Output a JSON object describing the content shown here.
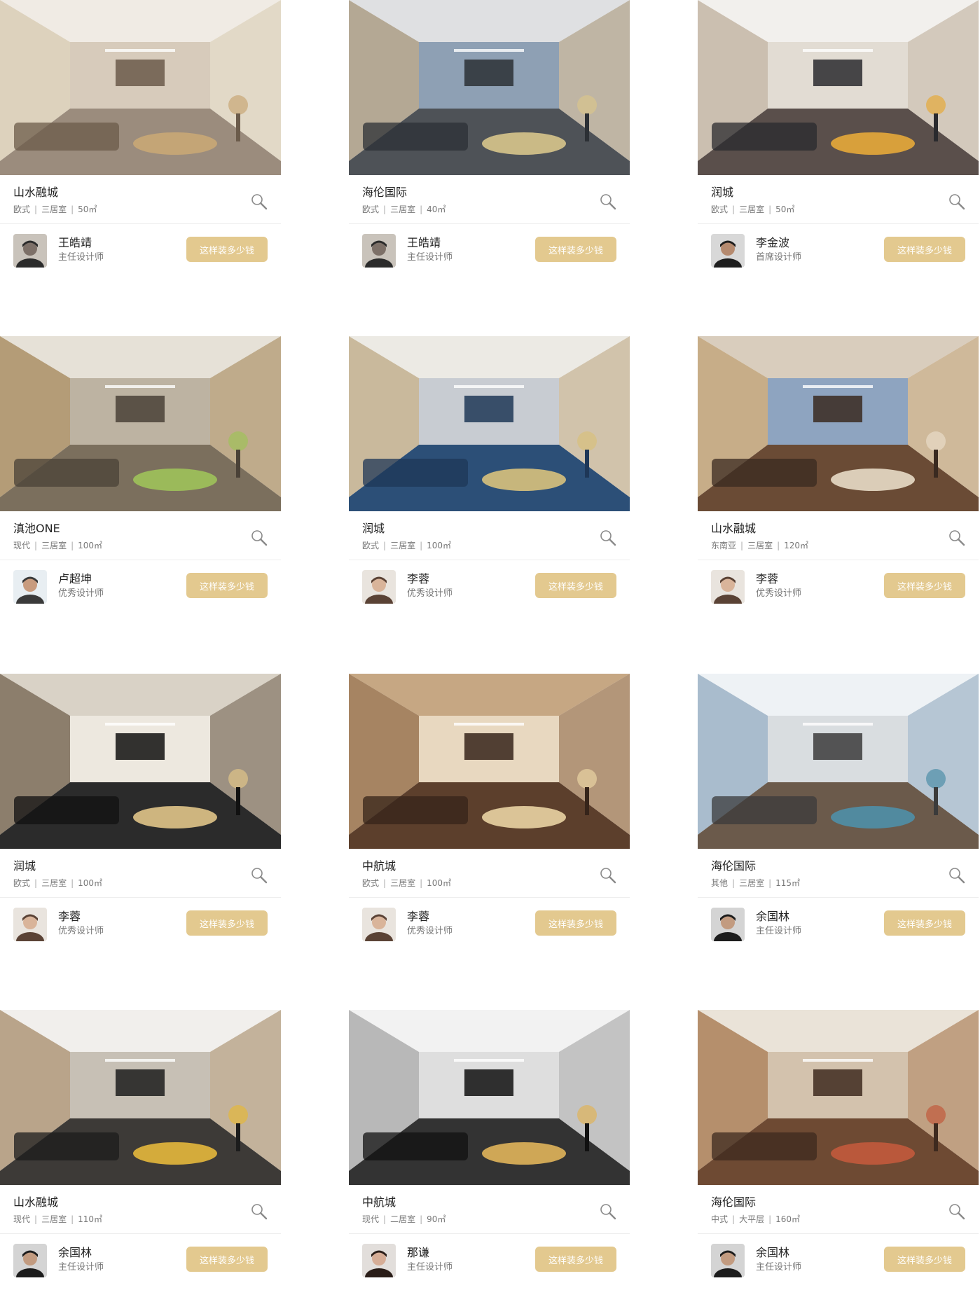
{
  "theme": {
    "button_bg": "#e3c98f",
    "button_text": "#ffffff",
    "divider": "#eeeeee",
    "icon": "#8a8a8a"
  },
  "cards": [
    {
      "project": "山水融城",
      "style": "欧式",
      "rooms": "三居室",
      "area": "50㎡",
      "designer": "王皓靖",
      "role": "主任设计师",
      "button": "这样装多少钱",
      "palette": [
        "#f0ebe4",
        "#d7cbbb",
        "#ddd2bd",
        "#9b8c7d",
        "#6b5b4a",
        "#c9a776"
      ],
      "avatar_palette": [
        "#c9c3bb",
        "#2b2b2b",
        "#7d7068"
      ]
    },
    {
      "project": "海伦国际",
      "style": "欧式",
      "rooms": "三居室",
      "area": "40㎡",
      "designer": "王皓靖",
      "role": "主任设计师",
      "button": "这样装多少钱",
      "palette": [
        "#dfe0e2",
        "#8ea0b4",
        "#b4a894",
        "#4e5257",
        "#2c3035",
        "#d8c58c"
      ],
      "avatar_palette": [
        "#c9c3bb",
        "#2b2b2b",
        "#7d7068"
      ]
    },
    {
      "project": "润城",
      "style": "欧式",
      "rooms": "三居室",
      "area": "50㎡",
      "designer": "李金波",
      "role": "首席设计师",
      "button": "这样装多少钱",
      "palette": [
        "#f2f0ed",
        "#e2dcd3",
        "#cbbfb0",
        "#5a4f4b",
        "#2a2a2e",
        "#e6a93a"
      ],
      "avatar_palette": [
        "#d8d8d8",
        "#1e1e1e",
        "#b58a6f"
      ]
    },
    {
      "project": "滇池ONE",
      "style": "现代",
      "rooms": "三居室",
      "area": "100㎡",
      "designer": "卢超坤",
      "role": "优秀设计师",
      "button": "这样装多少钱",
      "palette": [
        "#e6e1d7",
        "#bdb3a2",
        "#b49c77",
        "#7b6f5d",
        "#4a4137",
        "#9fc25a"
      ],
      "avatar_palette": [
        "#e8eef2",
        "#3a3a3a",
        "#c89b7e"
      ]
    },
    {
      "project": "润城",
      "style": "欧式",
      "rooms": "三居室",
      "area": "100㎡",
      "designer": "李蓉",
      "role": "优秀设计师",
      "button": "这样装多少钱",
      "palette": [
        "#eceae4",
        "#c8ccd2",
        "#c9b99c",
        "#2c4f77",
        "#1e3757",
        "#d8c17c"
      ],
      "avatar_palette": [
        "#e9e4de",
        "#5a4235",
        "#d9b49a"
      ]
    },
    {
      "project": "山水融城",
      "style": "东南亚",
      "rooms": "三居室",
      "area": "120㎡",
      "designer": "李蓉",
      "role": "优秀设计师",
      "button": "这样装多少钱",
      "palette": [
        "#d9cdbd",
        "#8ea4c0",
        "#c7ad88",
        "#6a4b35",
        "#3a2a20",
        "#e8dcc7"
      ],
      "avatar_palette": [
        "#e9e4de",
        "#5a4235",
        "#d9b49a"
      ]
    },
    {
      "project": "润城",
      "style": "欧式",
      "rooms": "三居室",
      "area": "100㎡",
      "designer": "李蓉",
      "role": "优秀设计师",
      "button": "这样装多少钱",
      "palette": [
        "#d9d2c6",
        "#ede8df",
        "#8c7e6c",
        "#2b2b2b",
        "#111111",
        "#e0c488"
      ],
      "avatar_palette": [
        "#e9e4de",
        "#5a4235",
        "#d9b49a"
      ]
    },
    {
      "project": "中航城",
      "style": "欧式",
      "rooms": "三居室",
      "area": "100㎡",
      "designer": "李蓉",
      "role": "优秀设计师",
      "button": "这样装多少钱",
      "palette": [
        "#c6a783",
        "#e8d8c0",
        "#a68462",
        "#5c3f2c",
        "#36241a",
        "#e9d3a3"
      ],
      "avatar_palette": [
        "#e9e4de",
        "#5a4235",
        "#d9b49a"
      ]
    },
    {
      "project": "海伦国际",
      "style": "其他",
      "rooms": "三居室",
      "area": "115㎡",
      "designer": "余国林",
      "role": "主任设计师",
      "button": "这样装多少钱",
      "palette": [
        "#eef2f5",
        "#d9dde0",
        "#a9bccd",
        "#6b5a4b",
        "#3b3b3b",
        "#4f8fa8"
      ],
      "avatar_palette": [
        "#d4d4d4",
        "#1c1c1c",
        "#c29b80"
      ]
    },
    {
      "project": "山水融城",
      "style": "现代",
      "rooms": "三居室",
      "area": "110㎡",
      "designer": "余国林",
      "role": "主任设计师",
      "button": "这样装多少钱",
      "palette": [
        "#f1efec",
        "#c7c0b5",
        "#b9a48a",
        "#3d3a37",
        "#1c1c1c",
        "#e4b83c"
      ],
      "avatar_palette": [
        "#d4d4d4",
        "#1c1c1c",
        "#c29b80"
      ]
    },
    {
      "project": "中航城",
      "style": "现代",
      "rooms": "二居室",
      "area": "90㎡",
      "designer": "那谦",
      "role": "主任设计师",
      "button": "这样装多少钱",
      "palette": [
        "#f2f2f2",
        "#dedede",
        "#b8b8b8",
        "#333333",
        "#111111",
        "#e0b45a"
      ],
      "avatar_palette": [
        "#e2dedb",
        "#2a1d18",
        "#d6ad96"
      ]
    },
    {
      "project": "海伦国际",
      "style": "中式",
      "rooms": "大平层",
      "area": "160㎡",
      "designer": "余国林",
      "role": "主任设计师",
      "button": "这样装多少钱",
      "palette": [
        "#eae3d8",
        "#d3c2ad",
        "#b58f6c",
        "#6e4a33",
        "#3e2a1f",
        "#c25a3c"
      ],
      "avatar_palette": [
        "#d4d4d4",
        "#1c1c1c",
        "#c29b80"
      ]
    }
  ]
}
